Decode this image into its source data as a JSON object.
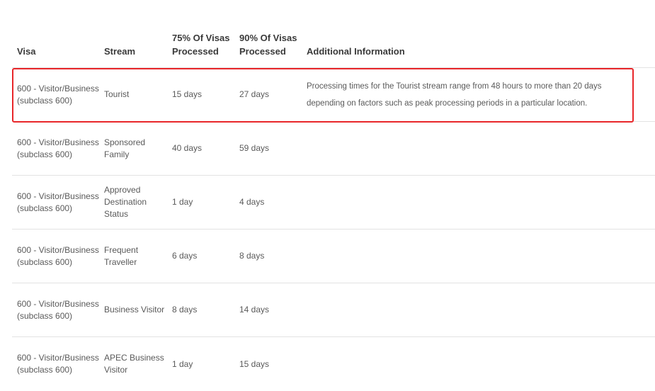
{
  "table": {
    "headers": {
      "visa": "Visa",
      "stream": "Stream",
      "p75": "75% Of Visas Processed",
      "p90": "90% Of Visas Processed",
      "info": "Additional Information"
    },
    "rows": [
      {
        "visa": "600 - Visitor/Business (subclass 600)",
        "stream": "Tourist",
        "p75": "15 days",
        "p90": "27 days",
        "info": "Processing times for the Tourist stream range from 48 hours to more than 20 days depending on factors such as peak processing periods in a particular location."
      },
      {
        "visa": "600 - Visitor/Business (subclass 600)",
        "stream": "Sponsored Family",
        "p75": "40 days",
        "p90": "59 days",
        "info": ""
      },
      {
        "visa": "600 - Visitor/Business (subclass 600)",
        "stream": "Approved Destination Status",
        "p75": "1 day",
        "p90": "4 days",
        "info": ""
      },
      {
        "visa": "600 - Visitor/Business (subclass 600)",
        "stream": "Frequent Traveller",
        "p75": "6 days",
        "p90": "8 days",
        "info": ""
      },
      {
        "visa": "600 - Visitor/Business (subclass 600)",
        "stream": "Business Visitor",
        "p75": "8 days",
        "p90": "14 days",
        "info": ""
      },
      {
        "visa": "600 - Visitor/Business (subclass 600)",
        "stream": "APEC Business Visitor",
        "p75": "1 day",
        "p90": "15 days",
        "info": ""
      }
    ]
  },
  "highlight": {
    "color": "#e8262a",
    "row_index": 0
  }
}
